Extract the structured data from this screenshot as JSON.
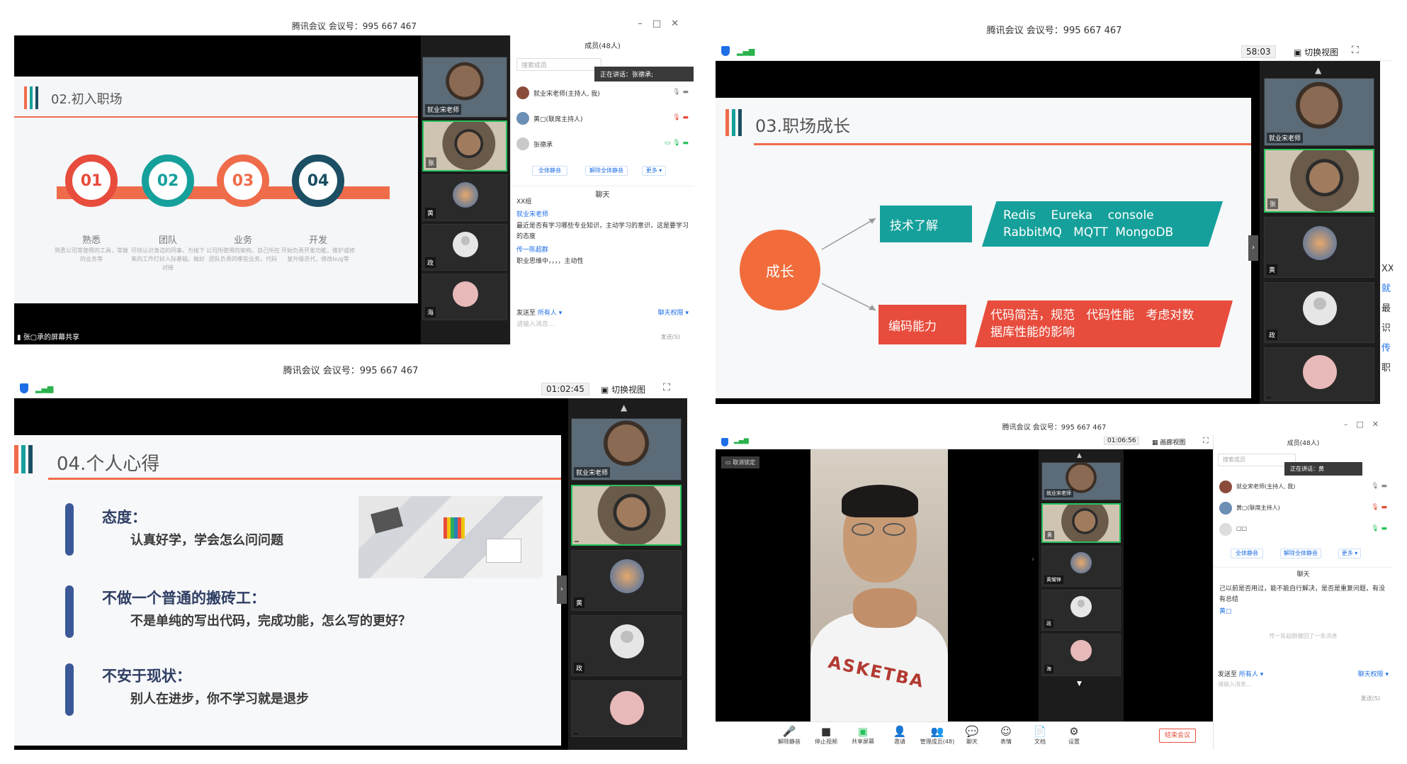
{
  "shot1": {
    "title": "腾讯会议 会议号：995 667 467",
    "slide_title": "02.初入职场",
    "steps": [
      {
        "num": "01",
        "label": "熟悉",
        "desc": "熟悉公司常使用的工具，常做的业务等",
        "color": "#e74c3c"
      },
      {
        "num": "02",
        "label": "团队",
        "desc": "尽快认识身边的同事，为接下来的工作打好人际基础、做好对接",
        "color": "#16a09b"
      },
      {
        "num": "03",
        "label": "业务",
        "desc": "公司所使用的架构，自己所在团队负责的哪些业务，代码",
        "color": "#ef6c4b"
      },
      {
        "num": "04",
        "label": "开发",
        "desc": "开始负责开发功能，维护或修复升级迭代，修改bug等",
        "color": "#1c4f63"
      }
    ],
    "share_label": "张▢承的屏幕共享",
    "tiles": [
      {
        "name": "就业宋老师"
      },
      {
        "name": "张"
      },
      {
        "name": "黄"
      },
      {
        "name": "政"
      },
      {
        "name": "海"
      }
    ],
    "members_header": "成员(48人)",
    "search_placeholder": "搜索成员",
    "speaking": "正在讲话：张德承;",
    "members": [
      {
        "name": "就业宋老师(主持人, 我)"
      },
      {
        "name": "黄▢(联席主持人)"
      },
      {
        "name": "张德承"
      }
    ],
    "btn_mute_all": "全体静音",
    "btn_unmute_all": "解除全体静音",
    "btn_more": "更多 ▾",
    "chat_header": "聊天",
    "chat": [
      {
        "text": "XX组",
        "cls": ""
      },
      {
        "text": "就业宋老师",
        "cls": "blue"
      },
      {
        "text": "最近是否有学习哪些专业知识，主动学习的意识，这是要学习的态度",
        "cls": ""
      },
      {
        "text": "传一陈超群",
        "cls": "blue"
      },
      {
        "text": "职业思维中，，，，主动性",
        "cls": ""
      }
    ],
    "send_to": "发送至",
    "send_target": "所有人 ▾",
    "chat_perm": "聊天权限 ▾",
    "input_placeholder": "请输入消息...",
    "send_btn": "发送(S)"
  },
  "shot2": {
    "title": "腾讯会议 会议号：995 667 467",
    "timer": "58:03",
    "switch_view": "切换视图",
    "slide_title": "03.职场成长",
    "growth": "成长",
    "tech_label": "技术了解",
    "tech_items_line1": "Redis    Eureka    console",
    "tech_items_line2": "RabbitMQ   MQTT  MongoDB",
    "code_label": "编码能力",
    "code_items_line1": "代码简洁，规范   代码性能   考虑对数",
    "code_items_line2": "据库性能的影响",
    "tiles": [
      {
        "name": "就业宋老师"
      },
      {
        "name": "张"
      },
      {
        "name": "黄"
      },
      {
        "name": "政"
      },
      {
        "name": ""
      }
    ],
    "edge_chat": [
      "XX",
      "就",
      "最",
      "识",
      "传",
      "职"
    ]
  },
  "shot3": {
    "title": "腾讯会议 会议号：995 667 467",
    "timer": "01:02:45",
    "switch_view": "切换视图",
    "slide_title": "04.个人心得",
    "items": [
      {
        "heading": "态度：",
        "sub": "认真好学，学会怎么问问题"
      },
      {
        "heading": "不做一个普通的搬砖工：",
        "sub": "不是单纯的写出代码，完成功能，怎么写的更好？"
      },
      {
        "heading": "不安于现状：",
        "sub": "别人在进步，你不学习就是退步"
      }
    ],
    "tiles": [
      {
        "name": "就业宋老师"
      },
      {
        "name": ""
      },
      {
        "name": "黄"
      },
      {
        "name": "政"
      },
      {
        "name": ""
      }
    ]
  },
  "shot4": {
    "title": "腾讯会议 会议号：995 667 467",
    "timer": "01:06:56",
    "switch_view": "画廊视图",
    "cancel_lock": "取消锁定",
    "shirt_text": "ASKETBA",
    "tiles": [
      {
        "name": "就业宋老师"
      },
      {
        "name": "黄"
      },
      {
        "name": "黄耀锋"
      },
      {
        "name": "政"
      },
      {
        "name": "海"
      }
    ],
    "members_header": "成员(48人)",
    "search_placeholder": "搜索成员",
    "speaking": "正在讲话：黄",
    "members": [
      {
        "name": "就业宋老师(主持人, 我)"
      },
      {
        "name": "黄▢(联席主持人)"
      },
      {
        "name": "▢▢"
      }
    ],
    "btn_mute_all": "全体静音",
    "btn_unmute_all": "解除全体静音",
    "btn_more": "更多 ▾",
    "chat_header": "聊天",
    "chat": [
      {
        "text": "己以前是否用过，能不能自行解决，是否是重复问题，有没有总结",
        "cls": ""
      },
      {
        "text": "黄▢",
        "cls": "blue"
      },
      {
        "text": "传一陈超群撤回了一条消息",
        "cls": "grey"
      }
    ],
    "send_to": "发送至",
    "send_target": "所有人 ▾",
    "chat_perm": "聊天权限 ▾",
    "input_placeholder": "请输入消息...",
    "send_btn": "发送(S)",
    "bottom": [
      {
        "icon": "🎤",
        "label": "解除静音"
      },
      {
        "icon": "■",
        "label": "停止视频"
      },
      {
        "icon": "▣",
        "label": "共享屏幕"
      },
      {
        "icon": "👤",
        "label": "邀请"
      },
      {
        "icon": "👥",
        "label": "管理成员(48)"
      },
      {
        "icon": "💬",
        "label": "聊天"
      },
      {
        "icon": "☺",
        "label": "表情"
      },
      {
        "icon": "📄",
        "label": "文档"
      },
      {
        "icon": "⚙",
        "label": "设置"
      }
    ],
    "end_meeting": "结束会议"
  }
}
